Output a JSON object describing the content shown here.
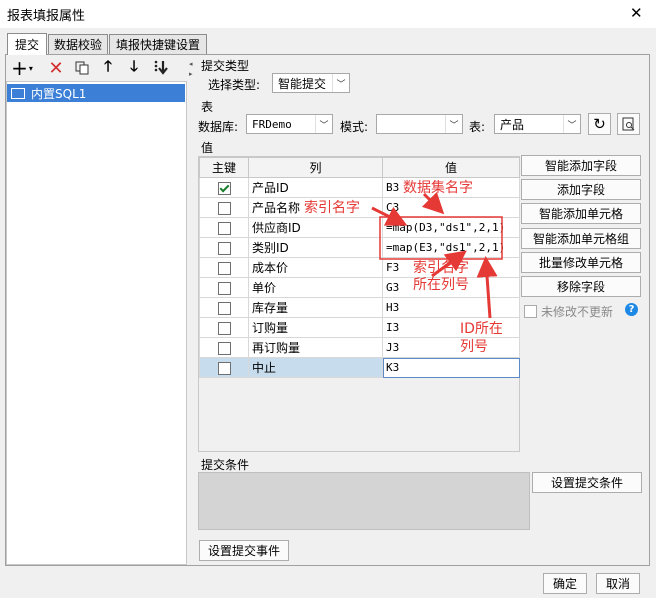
{
  "window": {
    "title": "报表填报属性",
    "close_glyph": "✕"
  },
  "tabs": [
    "提交",
    "数据校验",
    "填报快捷键设置"
  ],
  "toolbar_icons": [
    "add-icon",
    "delete-icon",
    "copy-icon",
    "move-up-icon",
    "move-down-icon",
    "move-bottom-icon"
  ],
  "left_list": {
    "items": [
      "内置SQL1"
    ]
  },
  "submit_type": {
    "section": "提交类型",
    "label": "选择类型:",
    "value": "智能提交"
  },
  "table_section": {
    "section": "表",
    "db_label": "数据库:",
    "db_value": "FRDemo",
    "mode_label": "模式:",
    "mode_value": "",
    "table_label": "表:",
    "table_value": "产品"
  },
  "value_section": {
    "section": "值",
    "columns": [
      "主键",
      "列",
      "值"
    ],
    "rows": [
      {
        "key": true,
        "col": "产品ID",
        "val": "B3"
      },
      {
        "key": false,
        "col": "产品名称",
        "val": "C3"
      },
      {
        "key": false,
        "col": "供应商ID",
        "val": "=map(D3,\"ds1\",2,1)"
      },
      {
        "key": false,
        "col": "类别ID",
        "val": "=map(E3,\"ds1\",2,1)"
      },
      {
        "key": false,
        "col": "成本价",
        "val": "F3"
      },
      {
        "key": false,
        "col": "单价",
        "val": "G3"
      },
      {
        "key": false,
        "col": "库存量",
        "val": "H3"
      },
      {
        "key": false,
        "col": "订购量",
        "val": "I3"
      },
      {
        "key": false,
        "col": "再订购量",
        "val": "J3"
      },
      {
        "key": false,
        "col": "中止",
        "val": "K3"
      }
    ]
  },
  "right_buttons": [
    "智能添加字段",
    "添加字段",
    "智能添加单元格",
    "智能添加单元格组",
    "批量修改单元格",
    "移除字段"
  ],
  "no_update_label": "未修改不更新",
  "submit_condition": {
    "section": "提交条件",
    "button": "设置提交条件"
  },
  "submit_event_button": "设置提交事件",
  "footer": {
    "ok": "确定",
    "cancel": "取消"
  },
  "annotations": {
    "index_name": "索引名字",
    "dataset_name": "数据集名字",
    "index_col": "索引名字\n所在列号",
    "id_col": "ID所在\n列号"
  },
  "colors": {
    "annotation": "#e53935",
    "selection": "#c7dcec",
    "list_selected": "#3b7fd6"
  }
}
